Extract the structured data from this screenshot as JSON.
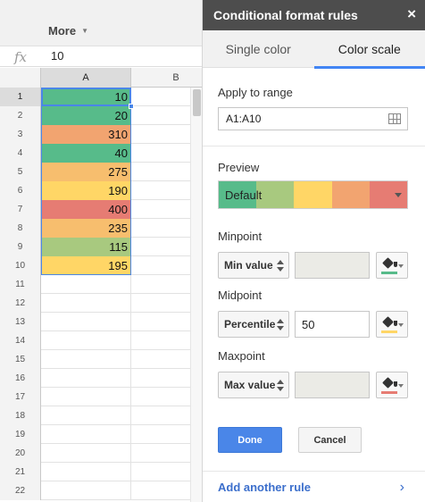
{
  "sheet": {
    "menu_more": "More",
    "fx_label": "fx",
    "formula_value": "10",
    "columns": [
      "A",
      "B"
    ],
    "rows": [
      {
        "n": "1",
        "a": "10",
        "color": "c-green"
      },
      {
        "n": "2",
        "a": "20",
        "color": "c-green"
      },
      {
        "n": "3",
        "a": "310",
        "color": "c-orange"
      },
      {
        "n": "4",
        "a": "40",
        "color": "c-green"
      },
      {
        "n": "5",
        "a": "275",
        "color": "c-lorange"
      },
      {
        "n": "6",
        "a": "190",
        "color": "c-yellow"
      },
      {
        "n": "7",
        "a": "400",
        "color": "c-red"
      },
      {
        "n": "8",
        "a": "235",
        "color": "c-lorange"
      },
      {
        "n": "9",
        "a": "115",
        "color": "c-lime"
      },
      {
        "n": "10",
        "a": "195",
        "color": "c-yellow"
      },
      {
        "n": "11",
        "a": "",
        "color": ""
      },
      {
        "n": "12",
        "a": "",
        "color": ""
      },
      {
        "n": "13",
        "a": "",
        "color": ""
      },
      {
        "n": "14",
        "a": "",
        "color": ""
      },
      {
        "n": "15",
        "a": "",
        "color": ""
      },
      {
        "n": "16",
        "a": "",
        "color": ""
      },
      {
        "n": "17",
        "a": "",
        "color": ""
      },
      {
        "n": "18",
        "a": "",
        "color": ""
      },
      {
        "n": "19",
        "a": "",
        "color": ""
      },
      {
        "n": "20",
        "a": "",
        "color": ""
      },
      {
        "n": "21",
        "a": "",
        "color": ""
      },
      {
        "n": "22",
        "a": "",
        "color": ""
      }
    ]
  },
  "panel": {
    "title": "Conditional format rules",
    "close_icon": "×",
    "tabs": [
      {
        "label": "Single color",
        "active": false
      },
      {
        "label": "Color scale",
        "active": true
      }
    ],
    "apply_label": "Apply to range",
    "range_value": "A1:A10",
    "preview_label": "Preview",
    "preview_text": "Default",
    "preview_colors": [
      "#57bb8a",
      "#a8c97f",
      "#ffd666",
      "#f2a470",
      "#e67c73"
    ],
    "minpoint": {
      "label": "Minpoint",
      "type": "Min value",
      "value": "",
      "color": "#57bb8a"
    },
    "midpoint": {
      "label": "Midpoint",
      "type": "Percentile",
      "value": "50",
      "color": "#ffd666"
    },
    "maxpoint": {
      "label": "Maxpoint",
      "type": "Max value",
      "value": "",
      "color": "#e67c73"
    },
    "done_label": "Done",
    "cancel_label": "Cancel",
    "add_rule_label": "Add another rule",
    "add_rule_chevron": "›"
  },
  "colors": {
    "accent": "#4a86e8",
    "header_bg": "#4d4d4d",
    "scale_min": "#57bb8a",
    "scale_mid": "#ffd666",
    "scale_max": "#e67c73"
  }
}
